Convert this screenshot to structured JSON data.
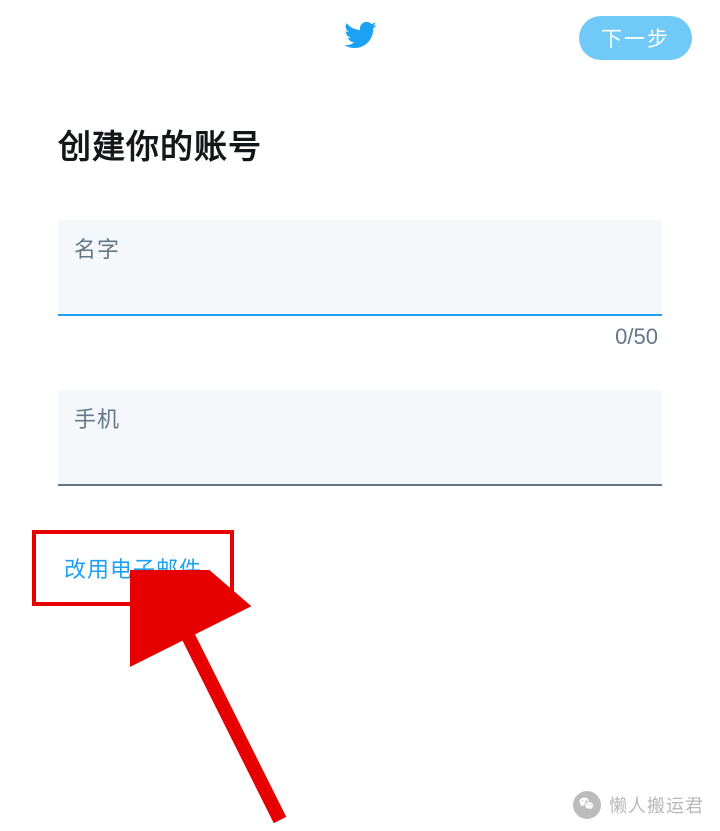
{
  "header": {
    "next_label": "下一步"
  },
  "title": "创建你的账号",
  "name_field": {
    "label": "名字",
    "value": "",
    "counter": "0/50"
  },
  "phone_field": {
    "label": "手机",
    "value": ""
  },
  "email_link": "改用电子邮件",
  "watermark": "懒人搬运君"
}
